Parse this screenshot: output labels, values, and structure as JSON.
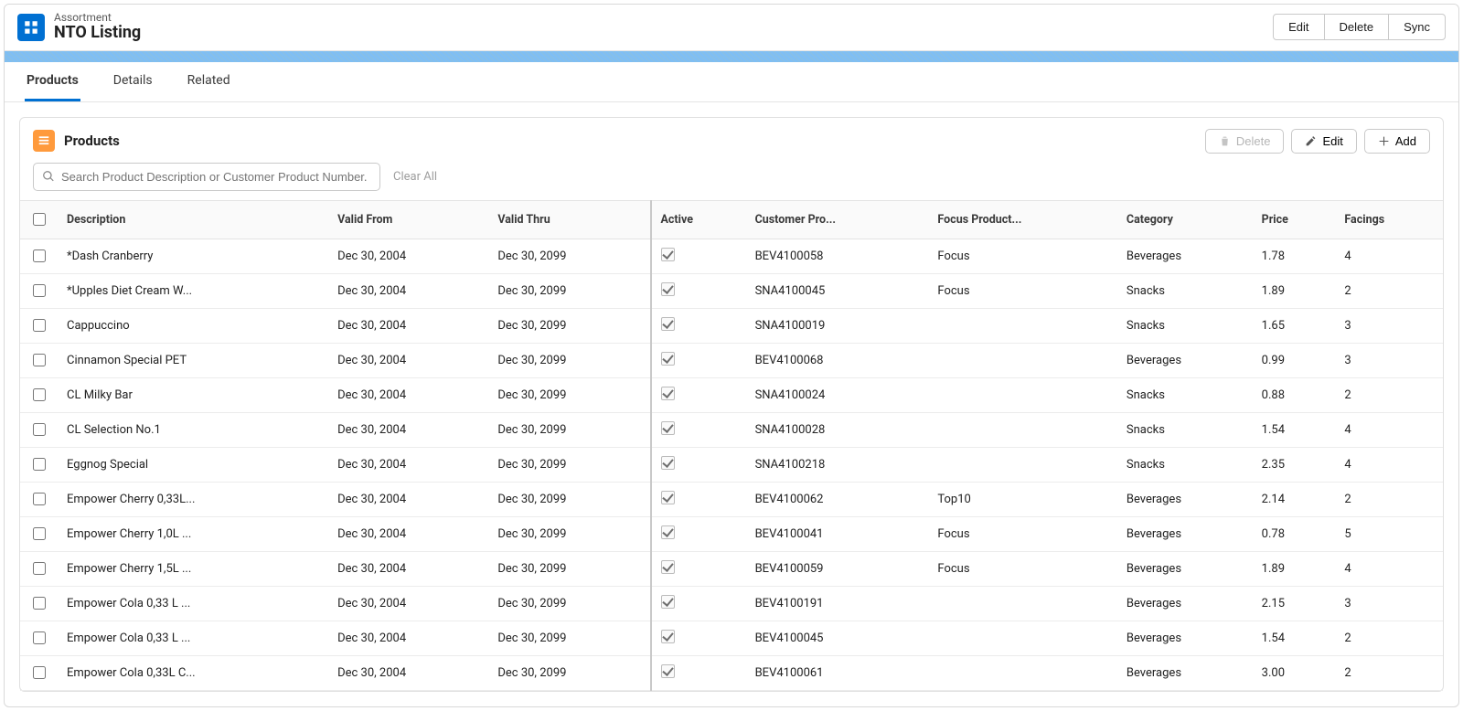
{
  "header": {
    "object_label": "Assortment",
    "title": "NTO Listing",
    "actions": {
      "edit": "Edit",
      "delete": "Delete",
      "sync": "Sync"
    }
  },
  "tabs": [
    {
      "label": "Products",
      "active": true
    },
    {
      "label": "Details",
      "active": false
    },
    {
      "label": "Related",
      "active": false
    }
  ],
  "panel": {
    "title": "Products",
    "delete_label": "Delete",
    "edit_label": "Edit",
    "add_label": "Add",
    "search_placeholder": "Search Product Description or Customer Product Number.",
    "clear_all": "Clear All"
  },
  "columns": {
    "description": "Description",
    "valid_from": "Valid From",
    "valid_thru": "Valid Thru",
    "active": "Active",
    "customer_prod": "Customer Pro...",
    "focus_prod": "Focus Product...",
    "category": "Category",
    "price": "Price",
    "facings": "Facings"
  },
  "rows": [
    {
      "description": "*Dash Cranberry",
      "valid_from": "Dec 30, 2004",
      "valid_thru": "Dec 30, 2099",
      "active": true,
      "customer": "BEV4100058",
      "focus": "Focus",
      "category": "Beverages",
      "price": "1.78",
      "facings": "4"
    },
    {
      "description": "*Upples Diet Cream W...",
      "valid_from": "Dec 30, 2004",
      "valid_thru": "Dec 30, 2099",
      "active": true,
      "customer": "SNA4100045",
      "focus": "Focus",
      "category": "Snacks",
      "price": "1.89",
      "facings": "2"
    },
    {
      "description": "Cappuccino",
      "valid_from": "Dec 30, 2004",
      "valid_thru": "Dec 30, 2099",
      "active": true,
      "customer": "SNA4100019",
      "focus": "",
      "category": "Snacks",
      "price": "1.65",
      "facings": "3"
    },
    {
      "description": "Cinnamon Special PET",
      "valid_from": "Dec 30, 2004",
      "valid_thru": "Dec 30, 2099",
      "active": true,
      "customer": "BEV4100068",
      "focus": "",
      "category": "Beverages",
      "price": "0.99",
      "facings": "3"
    },
    {
      "description": "CL Milky Bar",
      "valid_from": "Dec 30, 2004",
      "valid_thru": "Dec 30, 2099",
      "active": true,
      "customer": "SNA4100024",
      "focus": "",
      "category": "Snacks",
      "price": "0.88",
      "facings": "2"
    },
    {
      "description": "CL Selection No.1",
      "valid_from": "Dec 30, 2004",
      "valid_thru": "Dec 30, 2099",
      "active": true,
      "customer": "SNA4100028",
      "focus": "",
      "category": "Snacks",
      "price": "1.54",
      "facings": "4"
    },
    {
      "description": "Eggnog Special",
      "valid_from": "Dec 30, 2004",
      "valid_thru": "Dec 30, 2099",
      "active": true,
      "customer": "SNA4100218",
      "focus": "",
      "category": "Snacks",
      "price": "2.35",
      "facings": "4"
    },
    {
      "description": "Empower Cherry 0,33L...",
      "valid_from": "Dec 30, 2004",
      "valid_thru": "Dec 30, 2099",
      "active": true,
      "customer": "BEV4100062",
      "focus": "Top10",
      "category": "Beverages",
      "price": "2.14",
      "facings": "2"
    },
    {
      "description": "Empower Cherry 1,0L ...",
      "valid_from": "Dec 30, 2004",
      "valid_thru": "Dec 30, 2099",
      "active": true,
      "customer": "BEV4100041",
      "focus": "Focus",
      "category": "Beverages",
      "price": "0.78",
      "facings": "5"
    },
    {
      "description": "Empower Cherry 1,5L ...",
      "valid_from": "Dec 30, 2004",
      "valid_thru": "Dec 30, 2099",
      "active": true,
      "customer": "BEV4100059",
      "focus": "Focus",
      "category": "Beverages",
      "price": "1.89",
      "facings": "4"
    },
    {
      "description": "Empower Cola 0,33 L ...",
      "valid_from": "Dec 30, 2004",
      "valid_thru": "Dec 30, 2099",
      "active": true,
      "customer": "BEV4100191",
      "focus": "",
      "category": "Beverages",
      "price": "2.15",
      "facings": "3"
    },
    {
      "description": "Empower Cola 0,33 L ...",
      "valid_from": "Dec 30, 2004",
      "valid_thru": "Dec 30, 2099",
      "active": true,
      "customer": "BEV4100045",
      "focus": "",
      "category": "Beverages",
      "price": "1.54",
      "facings": "2"
    },
    {
      "description": "Empower Cola 0,33L C...",
      "valid_from": "Dec 30, 2004",
      "valid_thru": "Dec 30, 2099",
      "active": true,
      "customer": "BEV4100061",
      "focus": "",
      "category": "Beverages",
      "price": "3.00",
      "facings": "2"
    }
  ]
}
